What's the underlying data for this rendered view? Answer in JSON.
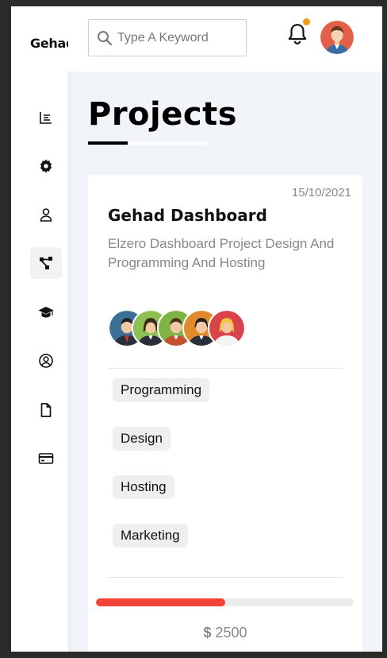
{
  "brand": "Gehad",
  "search": {
    "placeholder": "Type A Keyword",
    "value": ""
  },
  "page_title": "Projects",
  "sidebar": {
    "items": [
      {
        "icon": "chart-icon",
        "active": false
      },
      {
        "icon": "gear-icon",
        "active": false
      },
      {
        "icon": "user-icon",
        "active": false
      },
      {
        "icon": "diagram-icon",
        "active": true
      },
      {
        "icon": "graduation-cap-icon",
        "active": false
      },
      {
        "icon": "user-circle-icon",
        "active": false
      },
      {
        "icon": "file-icon",
        "active": false
      },
      {
        "icon": "credit-card-icon",
        "active": false
      }
    ]
  },
  "notifications": {
    "has_unread": true,
    "dot_color": "#f39c12"
  },
  "project": {
    "date": "15/10/2021",
    "title": "Gehad Dashboard",
    "description": "Elzero Dashboard Project Design And Programming And Hosting",
    "tags": [
      "Programming",
      "Design",
      "Hosting",
      "Marketing"
    ],
    "progress_percent": 50,
    "progress_color": "#f44336",
    "currency_symbol": "$",
    "price": "2500"
  },
  "team_member_count": 5
}
